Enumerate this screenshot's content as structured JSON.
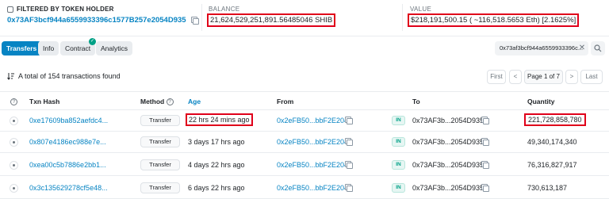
{
  "header": {
    "filter_label": "FILTERED BY TOKEN HOLDER",
    "holder_address": "0x73AF3bcf944a6559933396c1577B257e2054D935",
    "balance_label": "BALANCE",
    "balance_value": "21,624,529,251,891.56485046 SHIB",
    "value_label": "VALUE",
    "value_value": "$218,191,500.15 ( ~116,518.5653 Eth) [2.1625%]"
  },
  "tabs": [
    {
      "label": "Transfers",
      "active": true
    },
    {
      "label": "Info"
    },
    {
      "label": "Contract",
      "verified": true
    },
    {
      "label": "Analytics"
    }
  ],
  "filter_chip": {
    "address": "0x73af3bcf944a6559933396c..."
  },
  "summary": {
    "text": "A total of 154 transactions found"
  },
  "pagination": {
    "first": "First",
    "prev": "<",
    "page_text": "Page 1 of 7",
    "next": ">",
    "last": "Last"
  },
  "table": {
    "headers": {
      "hash": "Txn Hash",
      "method": "Method",
      "age": "Age",
      "from": "From",
      "to": "To",
      "quantity": "Quantity"
    },
    "rows": [
      {
        "hash": "0xe17609ba852aefdc4...",
        "method": "Transfer",
        "age": "22 hrs 24 mins ago",
        "from": "0x2eFB50...bbF2E204",
        "direction": "IN",
        "to": "0x73AF3b...2054D935",
        "quantity": "221,728,858,780"
      },
      {
        "hash": "0x807e4186ec988e7e...",
        "method": "Transfer",
        "age": "3 days 17 hrs ago",
        "from": "0x2eFB50...bbF2E204",
        "direction": "IN",
        "to": "0x73AF3b...2054D935",
        "quantity": "49,340,174,340"
      },
      {
        "hash": "0xea00c5b7886e2bb1...",
        "method": "Transfer",
        "age": "4 days 22 hrs ago",
        "from": "0x2eFB50...bbF2E204",
        "direction": "IN",
        "to": "0x73AF3b...2054D935",
        "quantity": "76,316,827,917"
      },
      {
        "hash": "0x3c135629278cf5e48...",
        "method": "Transfer",
        "age": "6 days 22 hrs ago",
        "from": "0x2eFB50...bbF2E204",
        "direction": "IN",
        "to": "0x73AF3b...2054D935",
        "quantity": "730,613,187"
      }
    ]
  },
  "colors": {
    "link": "#0784c3",
    "highlight": "#e0001a",
    "active_tab": "#0784c3",
    "in_badge": "#00a186"
  },
  "icons": [
    "filter-icon",
    "copy-icon",
    "close-icon",
    "search-icon",
    "sort-icon",
    "question-icon",
    "eye-icon",
    "check-icon"
  ]
}
